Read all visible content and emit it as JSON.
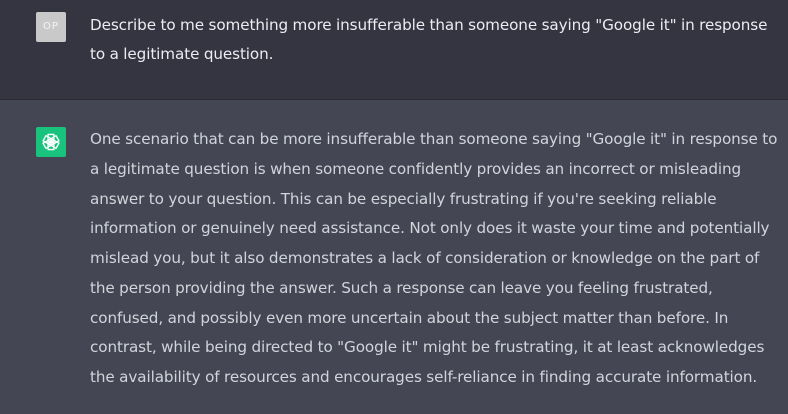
{
  "conversation": {
    "user": {
      "avatar_text": "OP",
      "message": "Describe to me something more insufferable than someone saying \"Google it\" in response to a legitimate question."
    },
    "assistant": {
      "avatar_icon": "openai-logo-icon",
      "message": "One scenario that can be more insufferable than someone saying \"Google it\" in response to a legitimate question is when someone confidently provides an incorrect or misleading answer to your question. This can be especially frustrating if you're seeking reliable information or genuinely need assistance. Not only does it waste your time and potentially mislead you, but it also demonstrates a lack of consideration or knowledge on the part of the person providing the answer. Such a response can leave you feeling frustrated, confused, and possibly even more uncertain about the subject matter than before. In contrast, while being directed to \"Google it\" might be frustrating, it at least acknowledges the availability of resources and encourages self-reliance in finding accurate information."
    }
  },
  "colors": {
    "user_row_bg": "#343541",
    "assistant_row_bg": "#444654",
    "assistant_avatar_bg": "#19c37d",
    "user_avatar_bg": "#c9c9c9",
    "text": "#ececf1"
  }
}
